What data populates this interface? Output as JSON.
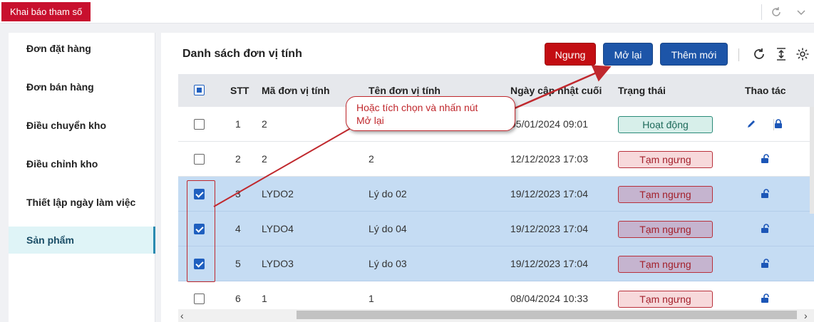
{
  "topbar": {
    "tab_label": "Khai báo tham số",
    "refresh_icon": "refresh-icon",
    "collapse_icon": "chevron-down-icon"
  },
  "sidebar": {
    "items": [
      {
        "label": "Đơn đặt hàng",
        "active": false
      },
      {
        "label": "Đơn bán hàng",
        "active": false
      },
      {
        "label": "Điều chuyển kho",
        "active": false
      },
      {
        "label": "Điều chỉnh kho",
        "active": false
      },
      {
        "label": "Thiết lập ngày làm việc",
        "active": false
      },
      {
        "label": "Sản phẩm",
        "active": true
      }
    ]
  },
  "main": {
    "title": "Danh sách đơn vị tính",
    "buttons": {
      "stop": "Ngưng",
      "reopen": "Mở lại",
      "new": "Thêm mới"
    },
    "tools": [
      "refresh-icon",
      "export-icon",
      "gear-icon"
    ]
  },
  "table": {
    "columns": [
      "STT",
      "Mã đơn vị tính",
      "Tên đơn vị tính",
      "Ngày cập nhật cuối",
      "Trạng thái",
      "Thao tác"
    ],
    "rows": [
      {
        "stt": "1",
        "code": "2",
        "name": "",
        "updated": "05/01/2024 09:01",
        "status": "Hoạt động",
        "status_kind": "active",
        "checked": false
      },
      {
        "stt": "2",
        "code": "2",
        "name": "2",
        "updated": "12/12/2023 17:03",
        "status": "Tạm ngưng",
        "status_kind": "paused",
        "checked": false
      },
      {
        "stt": "3",
        "code": "LYDO2",
        "name": "Lý do 02",
        "updated": "19/12/2023 17:04",
        "status": "Tạm ngưng",
        "status_kind": "paused",
        "checked": true
      },
      {
        "stt": "4",
        "code": "LYDO4",
        "name": "Lý do 04",
        "updated": "19/12/2023 17:04",
        "status": "Tạm ngưng",
        "status_kind": "paused",
        "checked": true
      },
      {
        "stt": "5",
        "code": "LYDO3",
        "name": "Lý do 03",
        "updated": "19/12/2023 17:04",
        "status": "Tạm ngưng",
        "status_kind": "paused",
        "checked": true
      },
      {
        "stt": "6",
        "code": "1",
        "name": "1",
        "updated": "08/04/2024 10:33",
        "status": "Tạm ngưng",
        "status_kind": "paused",
        "checked": false
      }
    ]
  },
  "annotation": {
    "line1": "Hoặc tích chọn và nhấn nút",
    "line2": "Mở lại"
  },
  "colors": {
    "brand_red": "#c8102e",
    "primary_blue": "#1d55a8",
    "selected_row": "#c5dcf3",
    "annotation_red": "#c0282d"
  }
}
